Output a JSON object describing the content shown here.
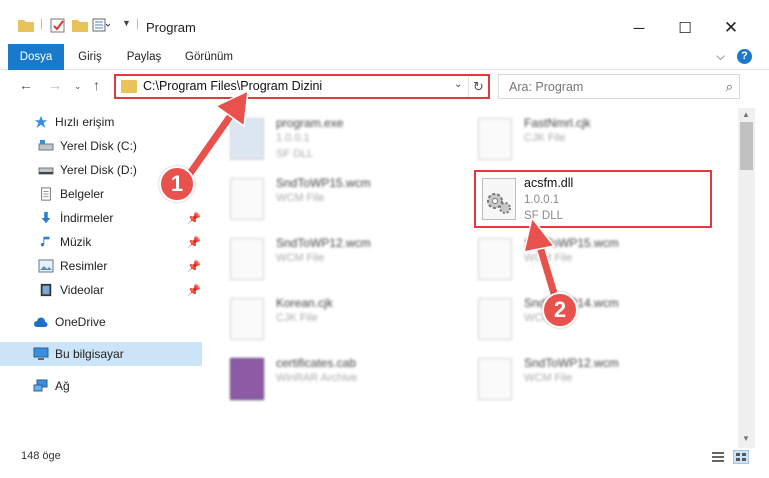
{
  "window": {
    "title": "Program"
  },
  "ribbon": {
    "tabs": [
      "Dosya",
      "Giriş",
      "Paylaş",
      "Görünüm"
    ],
    "help": "?"
  },
  "navbar": {
    "address": "C:\\Program Files\\Program Dizini",
    "search_placeholder": "Ara: Program"
  },
  "sidebar": {
    "items": [
      {
        "label": "Hızlı erişim",
        "icon": "star-icon"
      },
      {
        "label": "Yerel Disk (C:)",
        "icon": "drive-icon"
      },
      {
        "label": "Yerel Disk (D:)",
        "icon": "drive-icon"
      },
      {
        "label": "Belgeler",
        "icon": "document-icon"
      },
      {
        "label": "İndirmeler",
        "icon": "download-icon"
      },
      {
        "label": "Müzik",
        "icon": "music-icon"
      },
      {
        "label": "Resimler",
        "icon": "pictures-icon"
      },
      {
        "label": "Videolar",
        "icon": "video-icon"
      },
      {
        "label": "OneDrive",
        "icon": "cloud-icon"
      },
      {
        "label": "Bu bilgisayar",
        "icon": "computer-icon"
      },
      {
        "label": "Ağ",
        "icon": "network-icon"
      }
    ]
  },
  "files": [
    {
      "name": "program.exe",
      "line2": "1.0.0.1",
      "line3": "SF DLL"
    },
    {
      "name": "FastNmrl.cjk",
      "line2": "CJK File",
      "line3": ""
    },
    {
      "name": "SndToWP15.wcm",
      "line2": "WCM File",
      "line3": ""
    },
    {
      "name": "SndToWP12.wcm",
      "line2": "WCM File",
      "line3": ""
    },
    {
      "name": "SndToWP15.wcm",
      "line2": "WCM File",
      "line3": ""
    },
    {
      "name": "Korean.cjk",
      "line2": "CJK File",
      "line3": ""
    },
    {
      "name": "SndToWP14.wcm",
      "line2": "WCM File",
      "line3": ""
    },
    {
      "name": "certificates.cab",
      "line2": "WinRAR Archive",
      "line3": ""
    },
    {
      "name": "SndToWP12.wcm",
      "line2": "WCM File",
      "line3": ""
    }
  ],
  "highlighted_file": {
    "name": "acsfm.dll",
    "version": "1.0.0.1",
    "type": "SF DLL"
  },
  "status": {
    "count": "148 öge"
  },
  "callouts": [
    "1",
    "2"
  ],
  "colors": {
    "accent": "#1979ca",
    "highlight": "#e03a3a",
    "badge": "#e8514c"
  }
}
